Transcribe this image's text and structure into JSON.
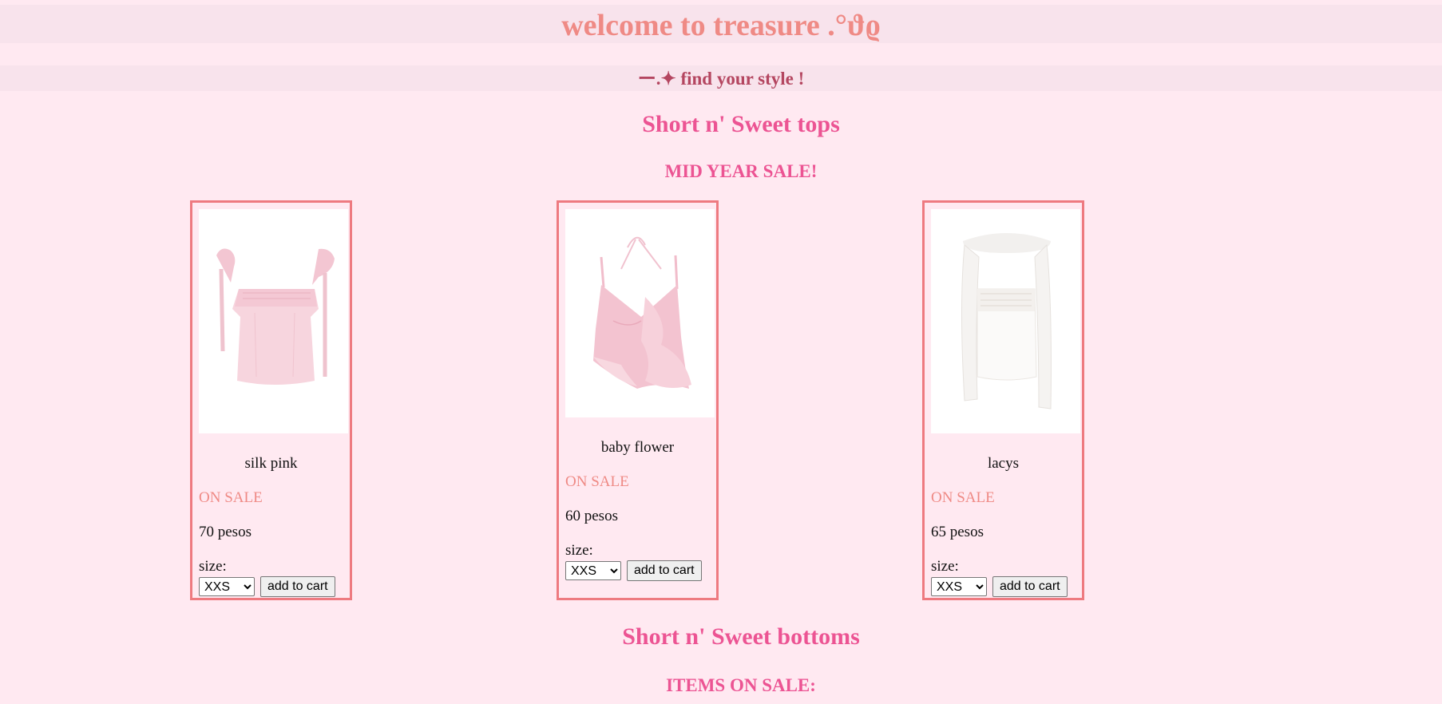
{
  "header": {
    "title": "welcome to treasure .°ϑϱ",
    "subtitle": "ー.✦ find your style !"
  },
  "tops_section": {
    "title": "Short n' Sweet tops",
    "subtitle": "MID YEAR SALE!"
  },
  "products": [
    {
      "name": "silk pink",
      "sale": "ON SALE",
      "price": "70 pesos",
      "size_label": "size:",
      "size_selected": "XXS",
      "button": "add to cart",
      "image": "pink-silk-top-image"
    },
    {
      "name": "baby flower",
      "sale": "ON SALE",
      "price": "60 pesos",
      "size_label": "size:",
      "size_selected": "XXS",
      "button": "add to cart",
      "image": "pink-ruffle-halter-top-image"
    },
    {
      "name": "lacys",
      "sale": "ON SALE",
      "price": "65 pesos",
      "size_label": "size:",
      "size_selected": "XXS",
      "button": "add to cart",
      "image": "white-scarf-top-image"
    }
  ],
  "bottoms_section": {
    "title": "Short n' Sweet bottoms",
    "subtitle": "ITEMS ON SALE:"
  },
  "colors": {
    "background": "#ffe9f1",
    "banner": "#f8e3ec",
    "accent_pink": "#ec5493",
    "salmon": "#ef8a85",
    "card_border": "#ee7a80"
  }
}
